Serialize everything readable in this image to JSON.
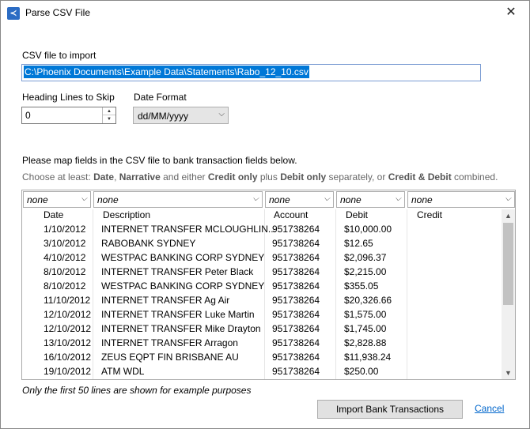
{
  "window": {
    "title": "Parse CSV File",
    "close_symbol": "✕"
  },
  "import": {
    "label": "CSV file to import",
    "path": "C:\\Phoenix Documents\\Example Data\\Statements\\Rabo_12_10.csv"
  },
  "heading_lines": {
    "label": "Heading Lines to Skip",
    "value": "0"
  },
  "date_format": {
    "label": "Date Format",
    "value": "dd/MM/yyyy"
  },
  "instructions": {
    "map_text": "Please map fields in the CSV file to bank transaction fields below.",
    "hint": [
      "Choose at least: ",
      "Date",
      ", ",
      "Narrative",
      " and either ",
      "Credit only",
      " plus ",
      "Debit only",
      " separately, or ",
      "Credit & Debit",
      " combined."
    ]
  },
  "mapping": [
    "none",
    "none",
    "none",
    "none",
    "none"
  ],
  "columns": [
    "Date",
    "Description",
    "Account",
    "Debit",
    "Credit"
  ],
  "rows": [
    [
      "1/10/2012",
      "INTERNET TRANSFER MCLOUGHLIN...",
      "951738264",
      "$10,000.00",
      ""
    ],
    [
      "3/10/2012",
      "RABOBANK SYDNEY",
      "951738264",
      "$12.65",
      ""
    ],
    [
      "4/10/2012",
      "WESTPAC BANKING CORP SYDNEY",
      "951738264",
      "$2,096.37",
      ""
    ],
    [
      "8/10/2012",
      "INTERNET TRANSFER Peter Black",
      "951738264",
      "$2,215.00",
      ""
    ],
    [
      "8/10/2012",
      "WESTPAC BANKING CORP SYDNEY",
      "951738264",
      "$355.05",
      ""
    ],
    [
      "11/10/2012",
      "INTERNET TRANSFER Ag Air",
      "951738264",
      "$20,326.66",
      ""
    ],
    [
      "12/10/2012",
      "INTERNET TRANSFER Luke Martin",
      "951738264",
      "$1,575.00",
      ""
    ],
    [
      "12/10/2012",
      "INTERNET TRANSFER Mike Drayton",
      "951738264",
      "$1,745.00",
      ""
    ],
    [
      "13/10/2012",
      "INTERNET TRANSFER Arragon",
      "951738264",
      "$2,828.88",
      ""
    ],
    [
      "16/10/2012",
      "ZEUS EQPT FIN BRISBANE AU",
      "951738264",
      "$11,938.24",
      ""
    ],
    [
      "19/10/2012",
      "ATM WDL",
      "951738264",
      "$250.00",
      ""
    ]
  ],
  "footer": {
    "note": "Only the first 50 lines are shown for example purposes",
    "import_label": "Import Bank Transactions",
    "cancel_label": "Cancel"
  },
  "colors": {
    "selection": "#0078d7",
    "link": "#0066cc",
    "accent_icon": "#2b6cc4"
  },
  "icons": {
    "app": "app-icon",
    "close": "close-icon",
    "dropdown": "chevron-down-icon",
    "spin_up": "spin-up-icon",
    "spin_down": "spin-down-icon",
    "scroll_up": "scroll-up-icon",
    "scroll_down": "scroll-down-icon"
  }
}
